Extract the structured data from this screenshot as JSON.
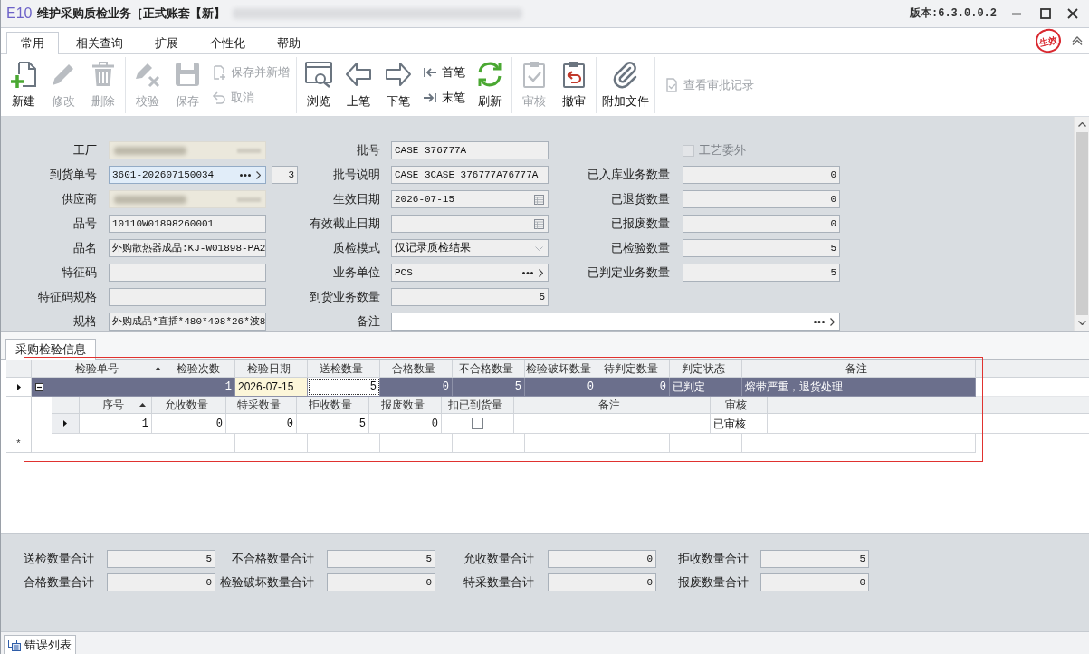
{
  "window": {
    "logo": "E10",
    "title": "维护采购质检业务［正式账套【新】",
    "version": "版本:6.3.0.0.2"
  },
  "ribbon_tabs": [
    {
      "label": "常用",
      "selected": true
    },
    {
      "label": "相关查询",
      "selected": false
    },
    {
      "label": "扩展",
      "selected": false
    },
    {
      "label": "个性化",
      "selected": false
    },
    {
      "label": "帮助",
      "selected": false
    }
  ],
  "status_stamp": "生效",
  "toolbar": [
    {
      "columns": [
        {
          "kind": "large",
          "label": "新建",
          "disabled": false
        },
        {
          "kind": "large",
          "label": "修改",
          "disabled": true
        },
        {
          "kind": "large",
          "label": "删除",
          "disabled": true
        }
      ]
    },
    {
      "columns": [
        {
          "kind": "large",
          "label": "校验",
          "disabled": true
        },
        {
          "kind": "large",
          "label": "保存",
          "disabled": true
        },
        {
          "kind": "stack",
          "buttons": [
            {
              "label": "保存并新增",
              "disabled": true
            },
            {
              "label": "取消",
              "disabled": true
            }
          ]
        }
      ]
    },
    {
      "columns": [
        {
          "kind": "large",
          "label": "浏览",
          "disabled": false
        },
        {
          "kind": "large",
          "label": "上笔",
          "disabled": false
        },
        {
          "kind": "large",
          "label": "下笔",
          "disabled": false
        },
        {
          "kind": "stack",
          "buttons": [
            {
              "label": "首笔",
              "disabled": false
            },
            {
              "label": "末笔",
              "disabled": false
            }
          ]
        },
        {
          "kind": "large",
          "label": "刷新",
          "disabled": false
        }
      ]
    },
    {
      "columns": [
        {
          "kind": "large",
          "label": "审核",
          "disabled": true
        },
        {
          "kind": "large",
          "label": "撤审",
          "disabled": false
        }
      ]
    },
    {
      "columns": [
        {
          "kind": "large",
          "label": "附加文件",
          "disabled": false
        }
      ]
    },
    {
      "columns": [
        {
          "kind": "inline",
          "label": "查看审批记录",
          "disabled": true
        }
      ]
    }
  ],
  "form": {
    "rows": [
      {
        "fields": [
          {
            "kind": "redacted",
            "label": "工厂",
            "focused": false
          },
          {
            "kind": "text",
            "label": "批号",
            "value": "CASE 376777A",
            "focused": false
          },
          {
            "kind": "checkbox",
            "label": "工艺委外",
            "checked": false,
            "disabled": true
          }
        ]
      },
      {
        "fields": [
          {
            "kind": "lookup",
            "label": "到货单号",
            "value": "3601-202607150034",
            "extra": "3",
            "focused": true
          },
          {
            "kind": "text",
            "label": "批号说明",
            "value": "CASE 3CASE 376777A76777A",
            "focused": false
          },
          {
            "kind": "number",
            "label": "已入库业务数量",
            "value": "0",
            "focused": false
          }
        ]
      },
      {
        "fields": [
          {
            "kind": "redacted",
            "label": "供应商",
            "focused": false
          },
          {
            "kind": "date",
            "label": "生效日期",
            "value": "2026-07-15",
            "focused": false
          },
          {
            "kind": "number",
            "label": "已退货数量",
            "value": "0",
            "focused": false
          }
        ]
      },
      {
        "fields": [
          {
            "kind": "text",
            "label": "品号",
            "value": "10110W01898260001",
            "focused": false
          },
          {
            "kind": "date",
            "label": "有效截止日期",
            "focused": false
          },
          {
            "kind": "number",
            "label": "已报废数量",
            "value": "0",
            "focused": false
          }
        ]
      },
      {
        "fields": [
          {
            "kind": "text",
            "label": "品名",
            "value": "外购散热器成品:KJ-W01898-PA2",
            "focused": false
          },
          {
            "kind": "select",
            "label": "质检模式",
            "value": "仅记录质检结果",
            "focused": false
          },
          {
            "kind": "number",
            "label": "已检验数量",
            "value": "5",
            "focused": false
          }
        ]
      },
      {
        "fields": [
          {
            "kind": "text",
            "label": "特征码",
            "focused": false
          },
          {
            "kind": "lookup",
            "label": "业务单位",
            "value": "PCS",
            "focused": false
          },
          {
            "kind": "number",
            "label": "已判定业务数量",
            "value": "5",
            "focused": false
          }
        ]
      },
      {
        "fields": [
          {
            "kind": "text",
            "label": "特征码规格",
            "focused": false
          },
          {
            "kind": "number",
            "label": "到货业务数量",
            "value": "5",
            "focused": false
          }
        ]
      },
      {
        "fields": [
          {
            "kind": "text",
            "label": "规格",
            "value": "外购成品*直插*480*408*26*波8",
            "focused": false
          },
          {
            "kind": "memo",
            "label": "备注",
            "focused": false
          }
        ]
      }
    ]
  },
  "detail_tabs": [
    {
      "label": "采购检验信息",
      "selected": true
    }
  ],
  "grid": {
    "columns": [
      {
        "label": "检验单号",
        "sorted": true
      },
      {
        "label": "检验次数",
        "sorted": false
      },
      {
        "label": "检验日期",
        "sorted": false
      },
      {
        "label": "送检数量",
        "sorted": false
      },
      {
        "label": "合格数量",
        "sorted": false
      },
      {
        "label": "不合格数量",
        "sorted": false
      },
      {
        "label": "检验破坏数量",
        "sorted": false
      },
      {
        "label": "待判定数量",
        "sorted": false
      },
      {
        "label": "判定状态",
        "sorted": false
      },
      {
        "label": "备注",
        "sorted": false
      }
    ],
    "rows": [
      {
        "selected": true,
        "expanded": true,
        "cells": [
          {
            "kind": "expander",
            "focused": false,
            "highlighted": false
          },
          {
            "kind": "number",
            "value": "1",
            "focused": false,
            "highlighted": false
          },
          {
            "kind": "text",
            "value": "2026-07-15",
            "focused": false,
            "highlighted": true
          },
          {
            "kind": "number",
            "value": "5",
            "focused": true,
            "highlighted": false
          },
          {
            "kind": "number",
            "value": "0",
            "focused": false,
            "highlighted": false
          },
          {
            "kind": "number",
            "value": "5",
            "focused": false,
            "highlighted": false
          },
          {
            "kind": "number",
            "value": "0",
            "focused": false,
            "highlighted": false
          },
          {
            "kind": "number",
            "value": "0",
            "focused": false,
            "highlighted": false
          },
          {
            "kind": "text",
            "value": "已判定",
            "focused": false,
            "highlighted": false
          },
          {
            "kind": "text",
            "value": "熔带严重，退货处理",
            "focused": false,
            "highlighted": false
          }
        ],
        "detail": {
          "columns": [
            {
              "label": "序号",
              "sorted": true
            },
            {
              "label": "允收数量",
              "sorted": false
            },
            {
              "label": "特采数量",
              "sorted": false
            },
            {
              "label": "拒收数量",
              "sorted": false
            },
            {
              "label": "报废数量",
              "sorted": false
            },
            {
              "label": "扣已到货量",
              "sorted": false
            },
            {
              "label": "备注",
              "sorted": false
            },
            {
              "label": "审核",
              "sorted": false
            }
          ],
          "rows": [
            {
              "current": true,
              "cells": [
                {
                  "kind": "number",
                  "value": "1"
                },
                {
                  "kind": "number",
                  "value": "0"
                },
                {
                  "kind": "number",
                  "value": "0"
                },
                {
                  "kind": "number",
                  "value": "5"
                },
                {
                  "kind": "number",
                  "value": "0"
                },
                {
                  "kind": "checkbox",
                  "checked": false
                },
                {
                  "kind": "blank"
                },
                {
                  "kind": "text",
                  "value": "已审核"
                }
              ]
            }
          ]
        }
      }
    ],
    "new_row_marker": "*"
  },
  "totals": [
    {
      "label": "送检数量合计",
      "value": "5"
    },
    {
      "label": "不合格数量合计",
      "value": "5"
    },
    {
      "label": "允收数量合计",
      "value": "0"
    },
    {
      "label": "拒收数量合计",
      "value": "5"
    },
    {
      "label": "合格数量合计",
      "value": "0"
    },
    {
      "label": "检验破坏数量合计",
      "value": "0"
    },
    {
      "label": "特采数量合计",
      "value": "0"
    },
    {
      "label": "报废数量合计",
      "value": "0"
    }
  ],
  "bottom_tabs": [
    {
      "label": "错误列表",
      "selected": true
    }
  ]
}
